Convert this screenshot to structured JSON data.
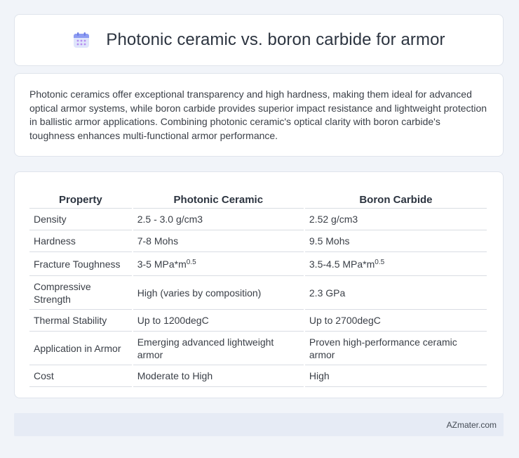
{
  "header": {
    "title": "Photonic ceramic vs. boron carbide for armor",
    "icon": "calendar-icon"
  },
  "summary": "Photonic ceramics offer exceptional transparency and high hardness, making them ideal for advanced optical armor systems, while boron carbide provides superior impact resistance and lightweight protection in ballistic armor applications. Combining photonic ceramic's optical clarity with boron carbide's toughness enhances multi-functional armor performance.",
  "table": {
    "headers": [
      "Property",
      "Photonic Ceramic",
      "Boron Carbide"
    ],
    "rows": [
      {
        "property": "Density",
        "photonic": "2.5 - 3.0 g/cm3",
        "boron": "2.52 g/cm3"
      },
      {
        "property": "Hardness",
        "photonic": "7-8 Mohs",
        "boron": "9.5 Mohs"
      },
      {
        "property": "Fracture Toughness",
        "photonic": "3-5 MPa*m",
        "photonic_exp": "0.5",
        "boron": "3.5-4.5 MPa*m",
        "boron_exp": "0.5"
      },
      {
        "property": "Compressive Strength",
        "photonic": "High (varies by composition)",
        "boron": "2.3 GPa"
      },
      {
        "property": "Thermal Stability",
        "photonic": "Up to 1200degC",
        "boron": "Up to 2700degC"
      },
      {
        "property": "Application in Armor",
        "photonic": "Emerging advanced lightweight armor",
        "boron": "Proven high-performance ceramic armor"
      },
      {
        "property": "Cost",
        "photonic": "Moderate to High",
        "boron": "High"
      }
    ]
  },
  "footer": {
    "site": "AZmater.com"
  },
  "colors": {
    "background": "#f1f4f9",
    "card": "#ffffff",
    "footer": "#e6ebf5",
    "icon_accent": "#7b8df0"
  }
}
